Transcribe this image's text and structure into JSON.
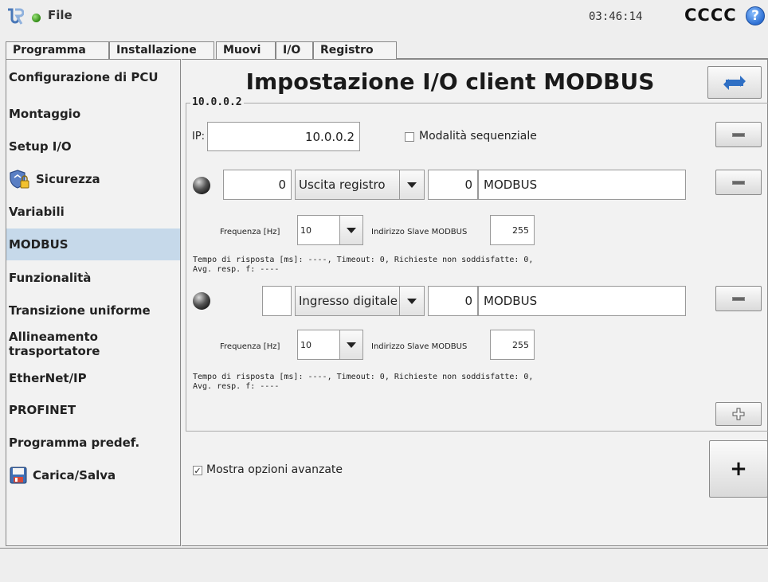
{
  "header": {
    "file_menu": "File",
    "clock": "03:46:14",
    "robot_name": "CCCC",
    "help_symbol": "?"
  },
  "tabs": [
    {
      "label": "Programma"
    },
    {
      "label": "Installazione",
      "active": true
    },
    {
      "label": "Muovi"
    },
    {
      "label": "I/O"
    },
    {
      "label": "Registro"
    }
  ],
  "sidebar": {
    "items": [
      {
        "label": "Configurazione di PCU"
      },
      {
        "label": "Montaggio"
      },
      {
        "label": "Setup I/O"
      },
      {
        "label": "Sicurezza",
        "icon": "shield-lock-icon"
      },
      {
        "label": "Variabili"
      },
      {
        "label": "MODBUS",
        "selected": true
      },
      {
        "label": "Funzionalità"
      },
      {
        "label": "Transizione uniforme"
      },
      {
        "label": "Allineamento trasportatore"
      },
      {
        "label": "EtherNet/IP"
      },
      {
        "label": "PROFINET"
      },
      {
        "label": "Programma predef."
      },
      {
        "label": "Carica/Salva",
        "icon": "floppy-disk-icon"
      }
    ]
  },
  "main": {
    "title": "Impostazione I/O client MODBUS",
    "client": {
      "group_label": "10.0.0.2",
      "ip_label": "IP:",
      "ip_value": "10.0.0.2",
      "sequential_mode_label": "Modalità sequenziale",
      "sequential_mode_checked": false,
      "signals": [
        {
          "address": "0",
          "type": "Uscita registro",
          "value": "0",
          "name": "MODBUS",
          "frequency_label": "Frequenza [Hz]",
          "frequency": "10",
          "slave_label": "Indirizzo Slave MODBUS",
          "slave_address": "255",
          "stats_line1": "Tempo di risposta [ms]: ----, Timeout: 0, Richieste non soddisfatte: 0,",
          "stats_line2": "Avg. resp. f: ----"
        },
        {
          "address": "",
          "type": "Ingresso digitale",
          "value": "0",
          "name": "MODBUS",
          "frequency_label": "Frequenza [Hz]",
          "frequency": "10",
          "slave_label": "Indirizzo Slave MODBUS",
          "slave_address": "255",
          "stats_line1": "Tempo di risposta [ms]: ----, Timeout: 0, Richieste non soddisfatte: 0,",
          "stats_line2": "Avg. resp. f: ----"
        }
      ]
    },
    "advanced_label": "Mostra opzioni avanzate",
    "advanced_checked": true,
    "add_client_symbol": "+"
  }
}
